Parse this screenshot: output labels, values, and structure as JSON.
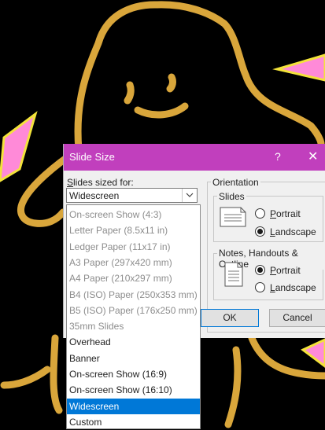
{
  "dialog": {
    "title": "Slide Size",
    "help_label": "?",
    "close_label": "✕",
    "sized_for_prefix": "S",
    "sized_for_rest": "lides sized for:",
    "sized_for_value": "Widescreen",
    "orientation_label": "Orientation",
    "slides_label": "Slides",
    "notes_label": "Notes, Handouts & Outline",
    "ok_label": "OK",
    "cancel_label": "Cancel",
    "slides_portrait": {
      "accel": "P",
      "rest": "ortrait",
      "checked": false
    },
    "slides_landscape": {
      "accel": "L",
      "rest": "andscape",
      "checked": true
    },
    "notes_portrait": {
      "accel": "P",
      "rest": "ortrait",
      "checked": true
    },
    "notes_landscape": {
      "accel": "L",
      "rest": "andscape",
      "checked": false
    }
  },
  "dropdown": {
    "items": [
      {
        "label": "On-screen Show (4:3)",
        "state": "disabled"
      },
      {
        "label": "Letter Paper (8.5x11 in)",
        "state": "disabled"
      },
      {
        "label": "Ledger Paper (11x17 in)",
        "state": "disabled"
      },
      {
        "label": "A3 Paper (297x420 mm)",
        "state": "disabled"
      },
      {
        "label": "A4 Paper (210x297 mm)",
        "state": "disabled"
      },
      {
        "label": "B4 (ISO) Paper (250x353 mm)",
        "state": "disabled"
      },
      {
        "label": "B5 (ISO) Paper (176x250 mm)",
        "state": "disabled"
      },
      {
        "label": "35mm Slides",
        "state": "disabled"
      },
      {
        "label": "Overhead",
        "state": "enabled"
      },
      {
        "label": "Banner",
        "state": "enabled"
      },
      {
        "label": "On-screen Show (16:9)",
        "state": "enabled"
      },
      {
        "label": "On-screen Show (16:10)",
        "state": "enabled"
      },
      {
        "label": "Widescreen",
        "state": "selected"
      },
      {
        "label": "Custom",
        "state": "enabled"
      }
    ]
  },
  "colors": {
    "title_bar": "#c13fbd",
    "selection": "#0078d7",
    "doodle": "#d9a63b",
    "triangle": "#ff8ad8"
  }
}
